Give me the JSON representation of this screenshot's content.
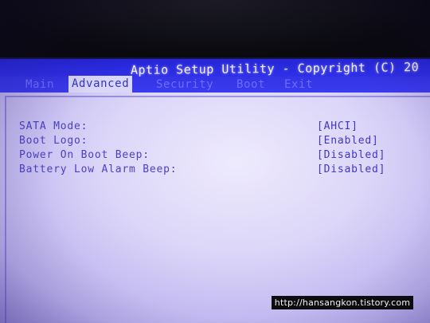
{
  "header": {
    "title": "Aptio Setup Utility - Copyright (C) 20"
  },
  "tabs": [
    {
      "label": "Main",
      "active": false
    },
    {
      "label": "Advanced",
      "active": true
    },
    {
      "label": "Security",
      "active": false
    },
    {
      "label": "Boot",
      "active": false
    },
    {
      "label": "Exit",
      "active": false
    }
  ],
  "settings": [
    {
      "label": "SATA Mode:",
      "value": "[AHCI]"
    },
    {
      "label": "Boot Logo:",
      "value": "[Enabled]"
    },
    {
      "label": "Power On Boot Beep:",
      "value": "[Disabled]"
    },
    {
      "label": "Battery Low Alarm Beep:",
      "value": "[Disabled]"
    }
  ],
  "watermark": "http://hansangkon.tistory.com",
  "colors": {
    "title_bar": "#2f2fe8",
    "tab_active_bg": "#d9d6f6",
    "text": "#4b40c4"
  }
}
